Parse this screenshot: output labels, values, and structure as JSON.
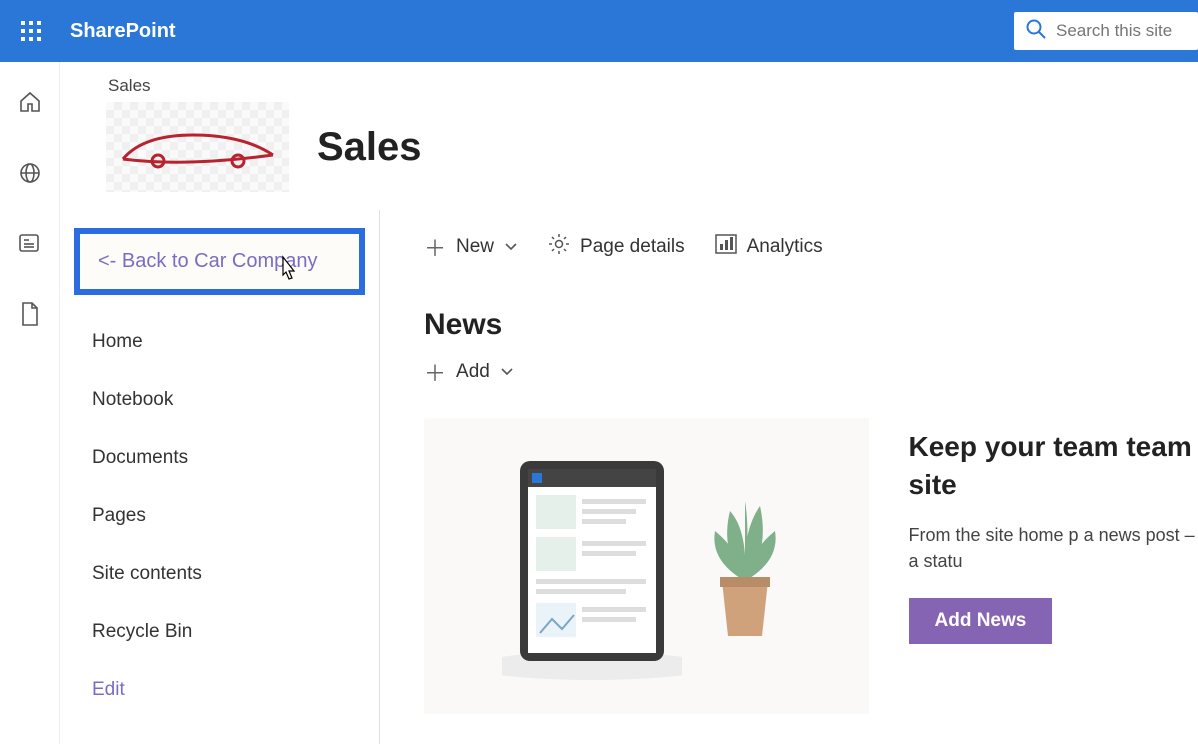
{
  "header": {
    "brand": "SharePoint",
    "search_placeholder": "Search this site"
  },
  "site": {
    "breadcrumb": "Sales",
    "title": "Sales"
  },
  "nav": {
    "back": "<- Back to Car Company",
    "items": [
      "Home",
      "Notebook",
      "Documents",
      "Pages",
      "Site contents",
      "Recycle Bin"
    ],
    "edit": "Edit"
  },
  "cmdbar": {
    "new": "New",
    "page_details": "Page details",
    "analytics": "Analytics"
  },
  "news": {
    "title": "News",
    "add": "Add",
    "promo_title": "Keep your team team site",
    "promo_body": "From the site home p a news post – a statu",
    "promo_button": "Add News"
  }
}
